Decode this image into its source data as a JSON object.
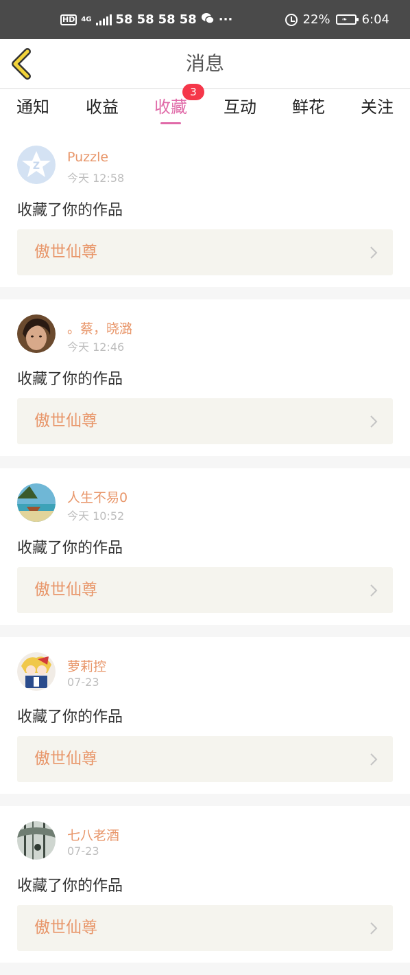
{
  "status_bar": {
    "hd": "HD",
    "network": "4G",
    "notifications": [
      "58",
      "58",
      "58",
      "58"
    ],
    "more": "···",
    "battery_percent": "22%",
    "time": "6:04",
    "icons": [
      "signal-icon",
      "wechat-icon",
      "alarm-icon",
      "battery-icon"
    ]
  },
  "header": {
    "title": "消息",
    "back_icon": "chevron-left-icon",
    "accent": "#f2d33a"
  },
  "tabs": {
    "items": [
      {
        "label": "通知"
      },
      {
        "label": "收益"
      },
      {
        "label": "收藏",
        "badge": "3",
        "active": true
      },
      {
        "label": "互动"
      },
      {
        "label": "鲜花"
      },
      {
        "label": "关注"
      }
    ],
    "active_color": "#e06aa8",
    "badge_color": "#f5374a"
  },
  "messages": [
    {
      "user": "Puzzle",
      "time": "今天 12:58",
      "action": "收藏了你的作品",
      "work": "傲世仙尊",
      "avatar": "qq-default-avatar"
    },
    {
      "user": "。蔡，晓潞",
      "time": "今天 12:46",
      "action": "收藏了你的作品",
      "work": "傲世仙尊",
      "avatar": "user-photo-avatar"
    },
    {
      "user": "人生不易0",
      "time": "今天 10:52",
      "action": "收藏了你的作品",
      "work": "傲世仙尊",
      "avatar": "landscape-avatar"
    },
    {
      "user": "萝莉控",
      "time": "07-23",
      "action": "收藏了你的作品",
      "work": "傲世仙尊",
      "avatar": "anime-avatar"
    },
    {
      "user": "七八老酒",
      "time": "07-23",
      "action": "收藏了你的作品",
      "work": "傲世仙尊",
      "avatar": "forest-avatar"
    }
  ],
  "colors": {
    "name": "#e8966a",
    "work_bg": "#f5f4ee",
    "page_bg": "#f6f6f6"
  }
}
